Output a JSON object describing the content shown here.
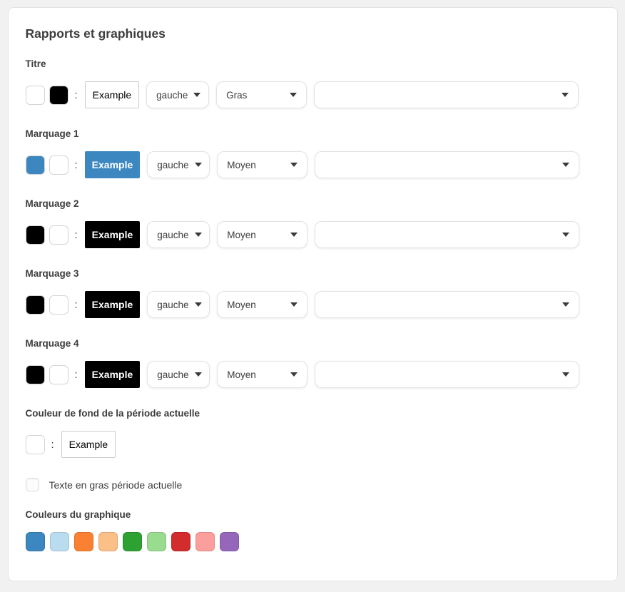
{
  "card": {
    "title": "Rapports et graphiques"
  },
  "colon": ":",
  "rows": [
    {
      "label": "Titre",
      "swatch1": "#ffffff",
      "swatch2": "#000000",
      "example": "Example",
      "example_bg": "#ffffff",
      "example_color": "#000000",
      "align": "gauche",
      "weight": "Gras",
      "font": ""
    },
    {
      "label": "Marquage 1",
      "swatch1": "#3d87c0",
      "swatch2": "#ffffff",
      "example": "Example",
      "example_bg": "#3d87c0",
      "example_color": "#ffffff",
      "align": "gauche",
      "weight": "Moyen",
      "font": ""
    },
    {
      "label": "Marquage 2",
      "swatch1": "#000000",
      "swatch2": "#ffffff",
      "example": "Example",
      "example_bg": "#000000",
      "example_color": "#ffffff",
      "align": "gauche",
      "weight": "Moyen",
      "font": ""
    },
    {
      "label": "Marquage 3",
      "swatch1": "#000000",
      "swatch2": "#ffffff",
      "example": "Example",
      "example_bg": "#000000",
      "example_color": "#ffffff",
      "align": "gauche",
      "weight": "Moyen",
      "font": ""
    },
    {
      "label": "Marquage 4",
      "swatch1": "#000000",
      "swatch2": "#ffffff",
      "example": "Example",
      "example_bg": "#000000",
      "example_color": "#ffffff",
      "align": "gauche",
      "weight": "Moyen",
      "font": ""
    }
  ],
  "period_bg": {
    "label": "Couleur de fond de la période actuelle",
    "swatch": "#ffffff",
    "example": "Example"
  },
  "bold_checkbox": {
    "label": "Texte en gras période actuelle",
    "checked": false
  },
  "chart_palette": {
    "label": "Couleurs du graphique",
    "colors": [
      "#3d87c0",
      "#b9dcee",
      "#fa8132",
      "#fbc088",
      "#2da233",
      "#99dc8f",
      "#d22c2c",
      "#fc9e9b",
      "#9567bb"
    ]
  }
}
